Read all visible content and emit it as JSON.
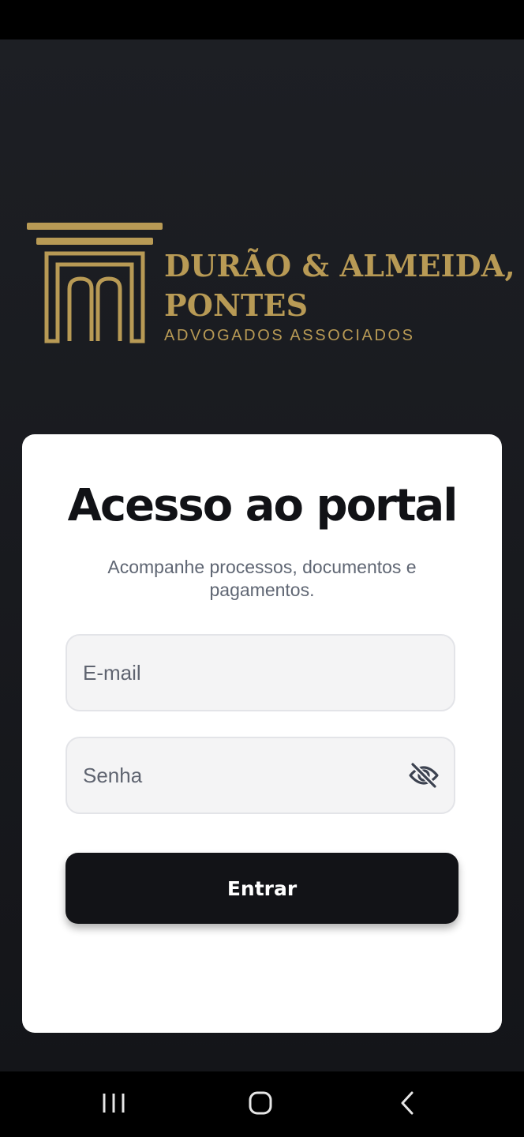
{
  "brand": {
    "name_line1": "DURÃO & ALMEIDA,",
    "name_line2": "PONTES",
    "tagline": "ADVOGADOS ASSOCIADOS",
    "logo_icon": "columns-logo-icon",
    "color": "#b89a55"
  },
  "login": {
    "title": "Acesso ao portal",
    "subtitle": "Acompanhe processos, documentos e pagamentos.",
    "email_placeholder": "E-mail",
    "email_value": "",
    "password_placeholder": "Senha",
    "password_value": "",
    "password_toggle_icon": "eye-off-icon",
    "submit_label": "Entrar"
  },
  "system_nav": {
    "recent_icon": "recent-apps-icon",
    "home_icon": "home-icon",
    "back_icon": "back-icon"
  },
  "colors": {
    "background": "#1a1b20",
    "card": "#ffffff",
    "button": "#121317",
    "accent_gold": "#b89a55"
  }
}
